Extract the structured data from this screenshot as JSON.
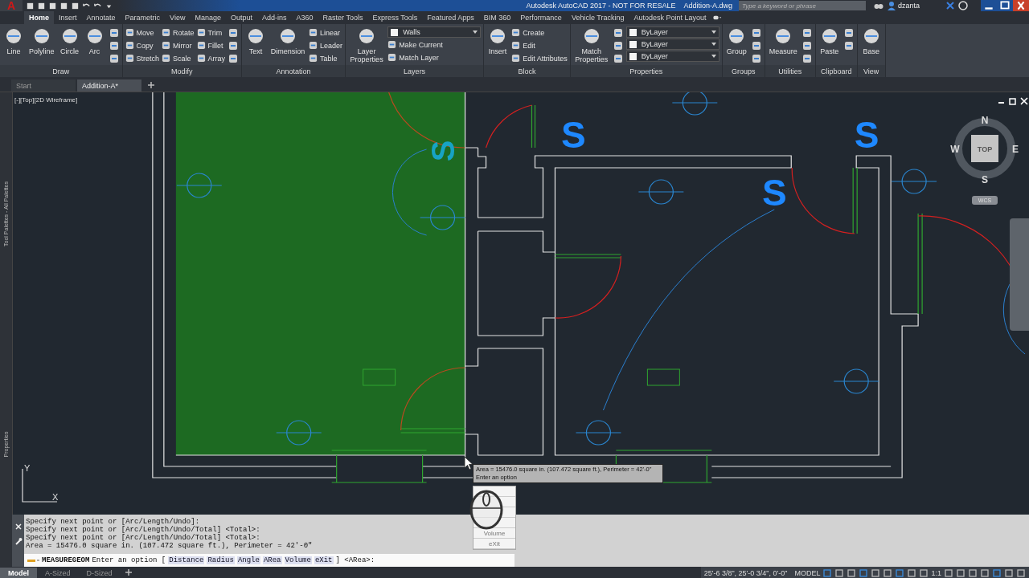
{
  "title_bar": {
    "app_button": "A",
    "product": "Autodesk AutoCAD 2017 - NOT FOR RESALE",
    "file": "Addition-A.dwg",
    "search": {
      "placeholder": "Type a keyword or phrase"
    },
    "user": "dzanta"
  },
  "ribbon_tabs": [
    {
      "label": "Home",
      "selected": true
    },
    {
      "label": "Insert",
      "selected": false
    },
    {
      "label": "Annotate",
      "selected": false
    },
    {
      "label": "Parametric",
      "selected": false
    },
    {
      "label": "View",
      "selected": false
    },
    {
      "label": "Manage",
      "selected": false
    },
    {
      "label": "Output",
      "selected": false
    },
    {
      "label": "Add-ins",
      "selected": false
    },
    {
      "label": "A360",
      "selected": false
    },
    {
      "label": "Raster Tools",
      "selected": false
    },
    {
      "label": "Express Tools",
      "selected": false
    },
    {
      "label": "Featured Apps",
      "selected": false
    },
    {
      "label": "BIM 360",
      "selected": false
    },
    {
      "label": "Performance",
      "selected": false
    },
    {
      "label": "Vehicle Tracking",
      "selected": false
    },
    {
      "label": "Autodesk Point Layout",
      "selected": false
    }
  ],
  "ribbon_panels": [
    {
      "title": "Draw",
      "columns": [
        [
          {
            "kind": "large",
            "label": "Line"
          }
        ],
        [
          {
            "kind": "large",
            "label": "Polyline"
          }
        ],
        [
          {
            "kind": "large",
            "label": "Circle"
          }
        ],
        [
          {
            "kind": "large",
            "label": "Arc"
          }
        ],
        [
          {
            "kind": "icon"
          },
          {
            "kind": "icon"
          },
          {
            "kind": "icon"
          }
        ]
      ]
    },
    {
      "title": "Modify",
      "columns": [
        [
          {
            "kind": "small",
            "label": "Move"
          },
          {
            "kind": "small",
            "label": "Copy"
          },
          {
            "kind": "small",
            "label": "Stretch"
          }
        ],
        [
          {
            "kind": "small",
            "label": "Rotate"
          },
          {
            "kind": "small",
            "label": "Mirror"
          },
          {
            "kind": "small",
            "label": "Scale"
          }
        ],
        [
          {
            "kind": "small",
            "label": "Trim"
          },
          {
            "kind": "small",
            "label": "Fillet"
          },
          {
            "kind": "small",
            "label": "Array"
          }
        ],
        [
          {
            "kind": "icon"
          },
          {
            "kind": "icon"
          },
          {
            "kind": "icon"
          }
        ]
      ]
    },
    {
      "title": "Annotation",
      "columns": [
        [
          {
            "kind": "large",
            "label": "Text"
          }
        ],
        [
          {
            "kind": "large",
            "label": "Dimension"
          }
        ],
        [
          {
            "kind": "small",
            "label": "Linear"
          },
          {
            "kind": "small",
            "label": "Leader"
          },
          {
            "kind": "small",
            "label": "Table"
          }
        ]
      ]
    },
    {
      "title": "Layers",
      "columns": [
        [
          {
            "kind": "large",
            "label": "Layer Properties"
          }
        ],
        [
          {
            "kind": "dropdown",
            "label": "Walls"
          },
          {
            "kind": "small",
            "label": "Make Current"
          },
          {
            "kind": "small",
            "label": "Match Layer"
          }
        ]
      ]
    },
    {
      "title": "Block",
      "columns": [
        [
          {
            "kind": "large",
            "label": "Insert"
          }
        ],
        [
          {
            "kind": "small",
            "label": "Create"
          },
          {
            "kind": "small",
            "label": "Edit"
          },
          {
            "kind": "small",
            "label": "Edit Attributes"
          }
        ]
      ]
    },
    {
      "title": "Properties",
      "columns": [
        [
          {
            "kind": "large",
            "label": "Match Properties"
          }
        ],
        [
          {
            "kind": "icon"
          },
          {
            "kind": "icon"
          },
          {
            "kind": "icon"
          }
        ],
        [
          {
            "kind": "dropdown",
            "label": "ByLayer"
          },
          {
            "kind": "dropdown",
            "label": "ByLayer"
          },
          {
            "kind": "dropdown",
            "label": "ByLayer"
          }
        ]
      ]
    },
    {
      "title": "Groups",
      "columns": [
        [
          {
            "kind": "large",
            "label": "Group"
          }
        ],
        [
          {
            "kind": "icon"
          },
          {
            "kind": "icon"
          },
          {
            "kind": "icon"
          }
        ]
      ]
    },
    {
      "title": "Utilities",
      "columns": [
        [
          {
            "kind": "large",
            "label": "Measure"
          }
        ],
        [
          {
            "kind": "icon"
          },
          {
            "kind": "icon"
          },
          {
            "kind": "icon"
          }
        ]
      ]
    },
    {
      "title": "Clipboard",
      "columns": [
        [
          {
            "kind": "large",
            "label": "Paste"
          }
        ],
        [
          {
            "kind": "icon"
          },
          {
            "kind": "icon"
          }
        ]
      ]
    },
    {
      "title": "View",
      "columns": [
        [
          {
            "kind": "large",
            "label": "Base"
          }
        ]
      ]
    }
  ],
  "file_tabs": [
    {
      "label": "Start",
      "selected": false
    },
    {
      "label": "Addition-A*",
      "selected": true
    }
  ],
  "viewport": {
    "label": "[-][Top][2D Wireframe]"
  },
  "palettes": [
    "Tool Palettes - All Palettes",
    "Properties"
  ],
  "drawing": {
    "labels": [
      "S",
      "S",
      "S",
      "S"
    ]
  },
  "viewcube": {
    "face": "TOP",
    "north": "N",
    "south": "S",
    "east": "E",
    "west": "W",
    "ucs": "WCS"
  },
  "ucs_icon": {
    "x_label": "X",
    "y_label": "Y"
  },
  "tooltip": {
    "lines": [
      "Area = 15476.0 square in. (107.472 square ft.), Perimeter = 42'-0\"",
      "Enter an option"
    ]
  },
  "option_menu": {
    "items": [
      "Volume",
      "eXit"
    ]
  },
  "command_history": [
    "Specify next point or [Arc/Length/Undo]:",
    "Specify next point or [Arc/Length/Undo/Total] <Total>:",
    "Specify next point or [Arc/Length/Undo/Total] <Total>:",
    "Area = 15476.0 square in. (107.472 square ft.), Perimeter = 42'-0\""
  ],
  "command_line": {
    "command": "MEASUREGEOM",
    "prompt": "Enter an option [",
    "options": [
      "Distance",
      "Radius",
      "Angle",
      "ARea",
      "Volume",
      "eXit"
    ],
    "suffix": "] <ARea>:"
  },
  "layout_tabs": [
    {
      "label": "Model",
      "selected": true
    },
    {
      "label": "A-Sized",
      "selected": false
    },
    {
      "label": "D-Sized",
      "selected": false
    }
  ],
  "status_bar": {
    "coordinates": "25'-6 3/8\", 25'-0 3/4\", 0'-0\"",
    "space": "MODEL",
    "scale": "1:1"
  }
}
